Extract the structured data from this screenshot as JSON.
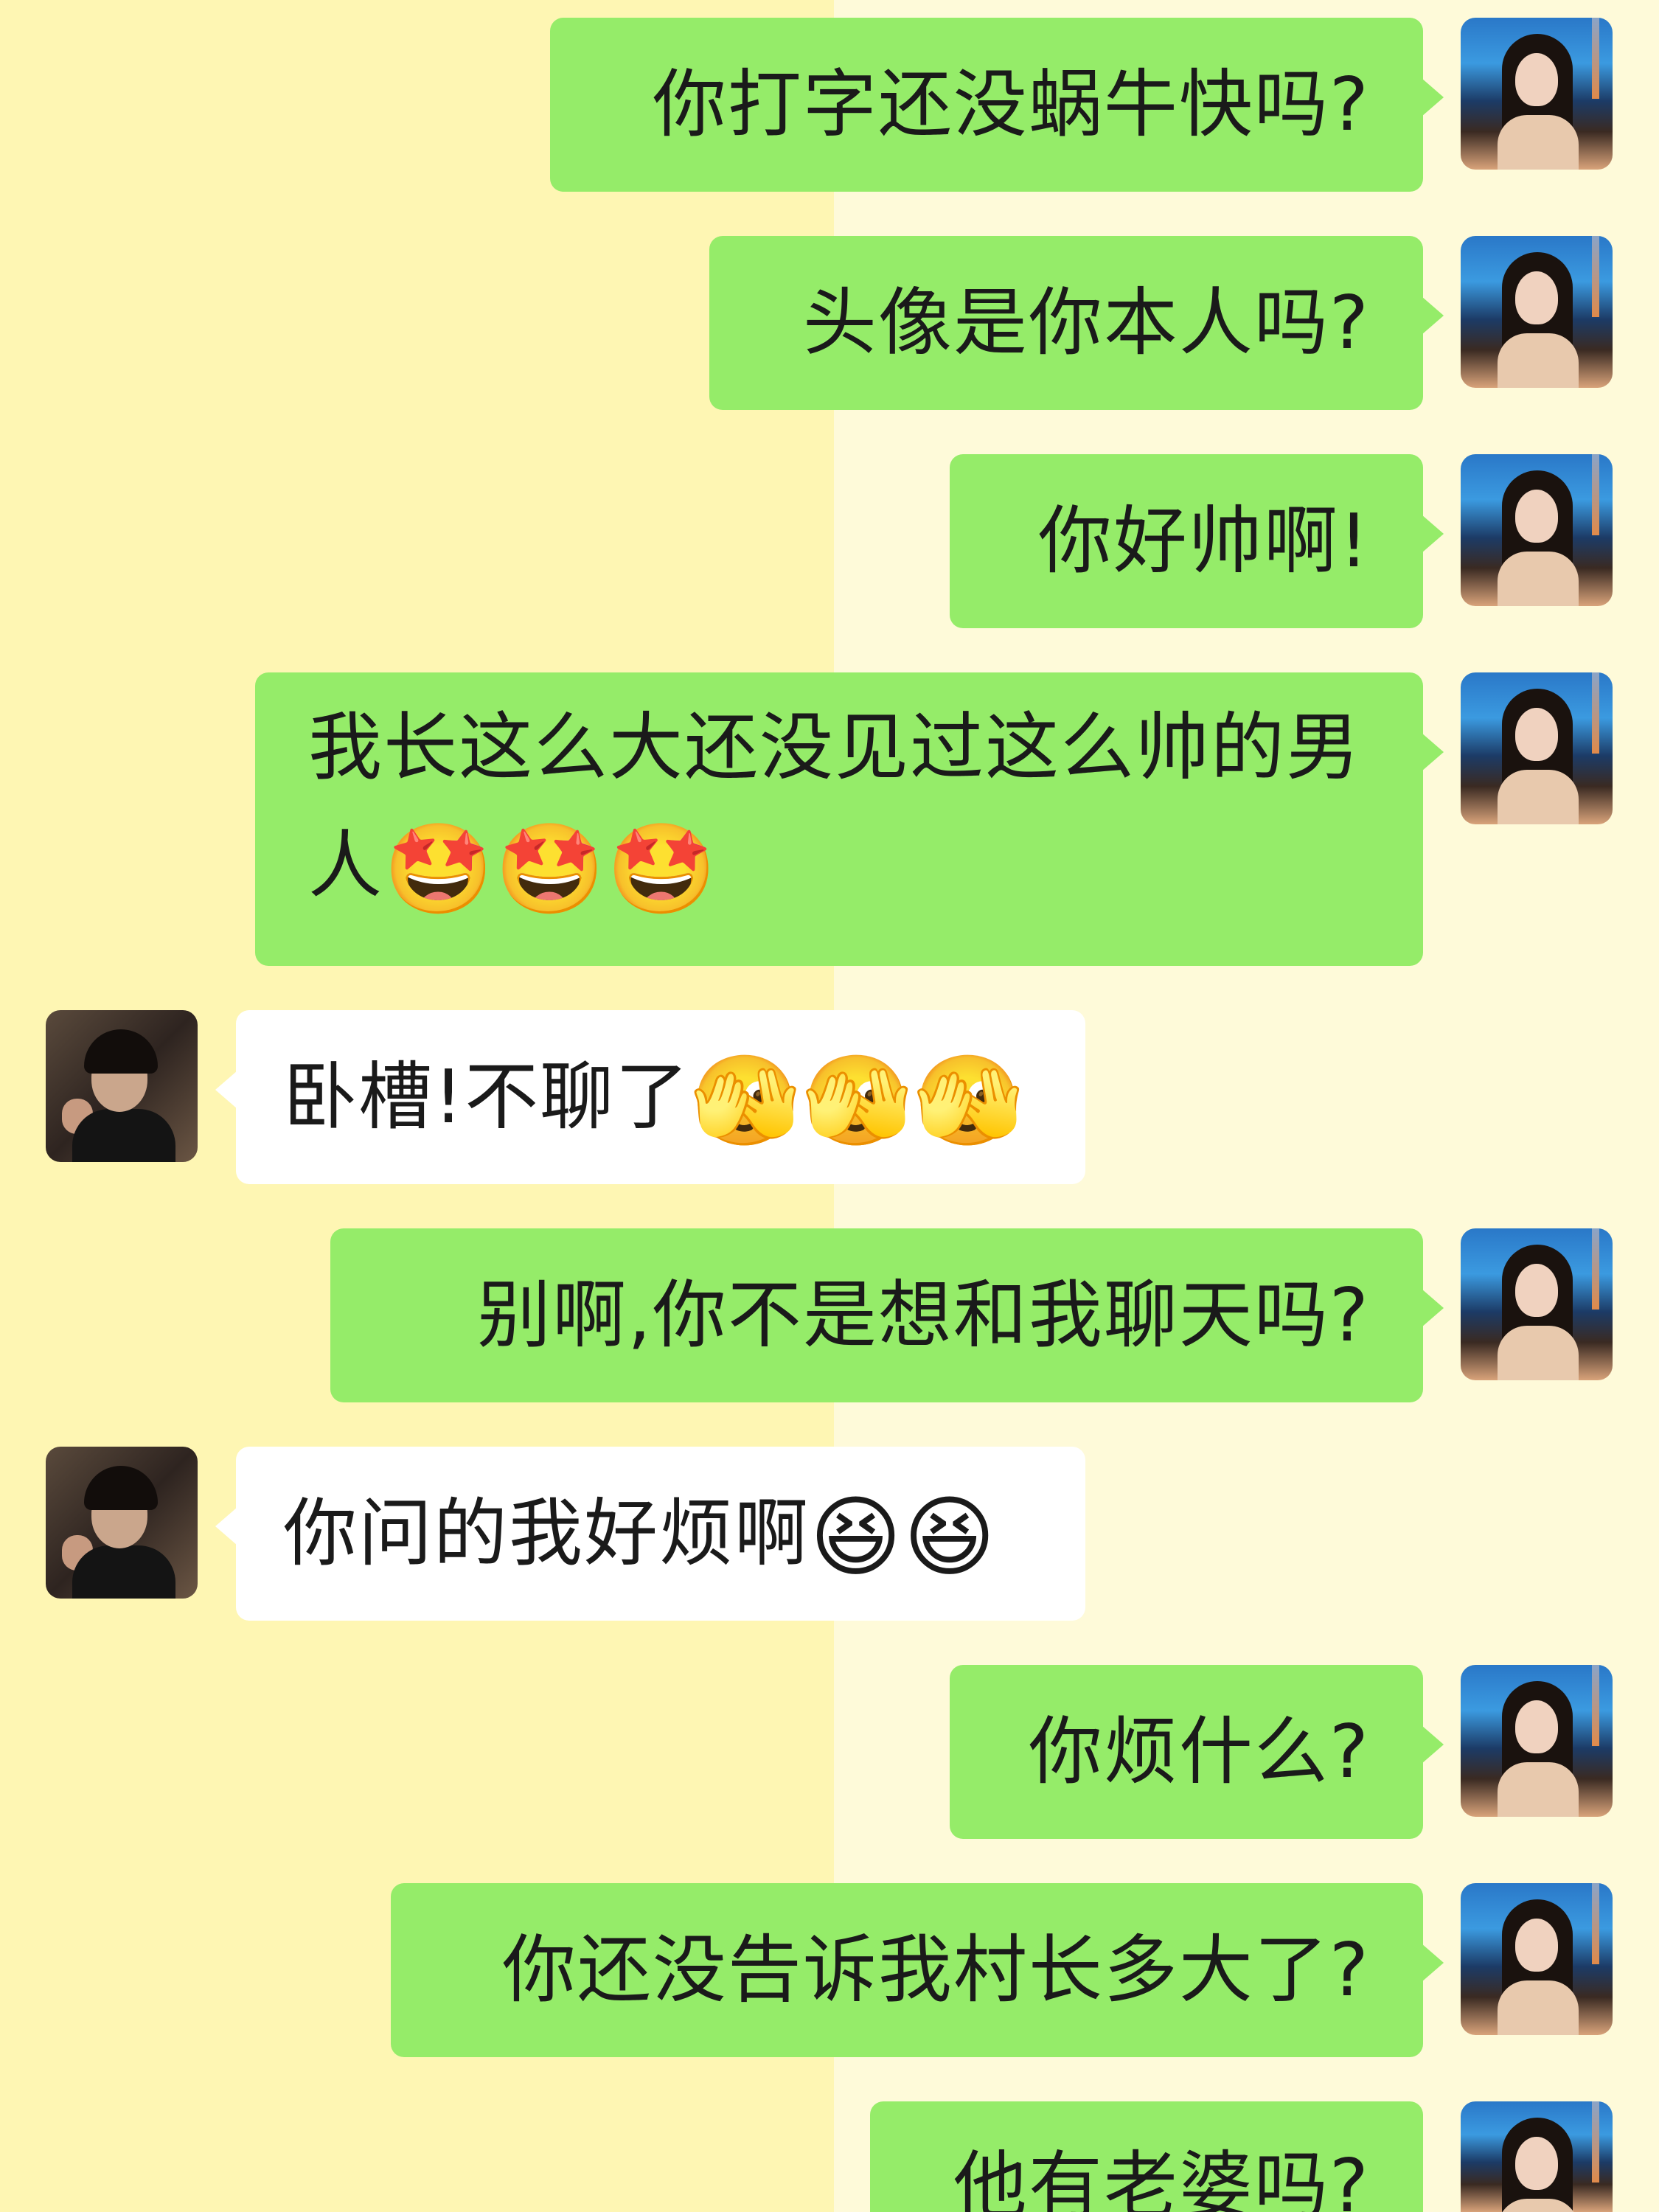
{
  "chat": {
    "messages": [
      {
        "sender": "me",
        "text": "你打字还没蜗牛快吗?"
      },
      {
        "sender": "me",
        "text": "头像是你本人吗?"
      },
      {
        "sender": "me",
        "text": "你好帅啊!"
      },
      {
        "sender": "me",
        "text": "我长这么大还没见过这么帅的男人",
        "emoji": "🤩🤩🤩"
      },
      {
        "sender": "them",
        "text": "卧槽!不聊了",
        "emoji": "🫣🫣🫣"
      },
      {
        "sender": "me",
        "text": "别啊,你不是想和我聊天吗?"
      },
      {
        "sender": "them",
        "text": "你问的我好烦啊",
        "emoji": "😆😆"
      },
      {
        "sender": "me",
        "text": "你烦什么?"
      },
      {
        "sender": "me",
        "text": "你还没告诉我村长多大了?"
      },
      {
        "sender": "me",
        "text": "他有老婆吗?"
      }
    ]
  },
  "colors": {
    "bubble_me": "#95EC69",
    "bubble_them": "#FFFFFF",
    "background_left": "#FEF6B3",
    "background_right": "#FEFAD9"
  },
  "icons": {
    "me_avatar": "avatar-woman-photo",
    "them_avatar": "avatar-man-photo"
  }
}
